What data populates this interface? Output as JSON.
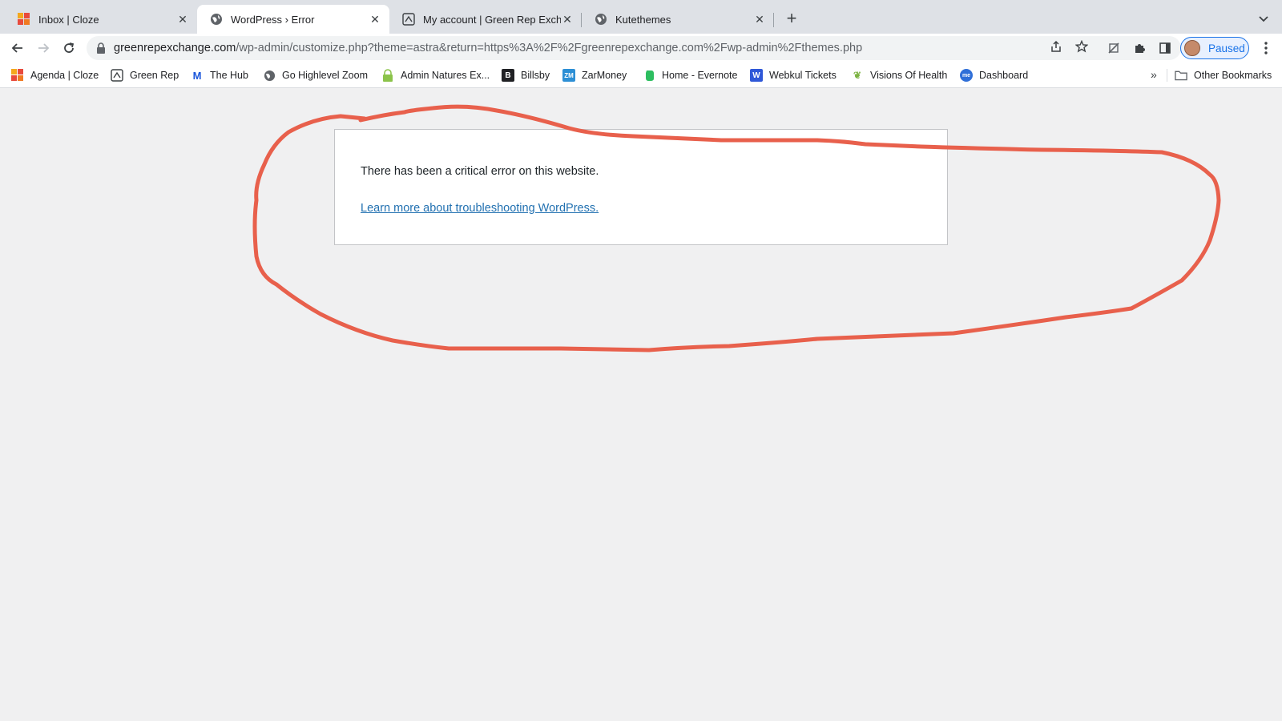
{
  "tabs": [
    {
      "title": "Inbox | Cloze",
      "icon": "cloze-icon",
      "active": false
    },
    {
      "title": "WordPress › Error",
      "icon": "globe-icon",
      "active": true
    },
    {
      "title": "My account | Green Rep Excha",
      "icon": "greenrep-icon",
      "active": false
    },
    {
      "title": "Kutethemes",
      "icon": "globe-icon",
      "active": false
    }
  ],
  "toolbar": {
    "url_host": "greenrepexchange.com",
    "url_path": "/wp-admin/customize.php?theme=astra&return=https%3A%2F%2Fgreenrepexchange.com%2Fwp-admin%2Fthemes.php",
    "profile_label": "Paused"
  },
  "bookmarks": {
    "items": [
      {
        "label": "Agenda | Cloze",
        "icon": "cloze-icon"
      },
      {
        "label": "Green Rep",
        "icon": "greenrep-icon"
      },
      {
        "label": "The Hub",
        "icon": "hub-icon"
      },
      {
        "label": "Go Highlevel Zoom",
        "icon": "globe-icon"
      },
      {
        "label": "Admin Natures Ex...",
        "icon": "lock-bag-icon"
      },
      {
        "label": "Billsby",
        "icon": "billsby-icon"
      },
      {
        "label": "ZarMoney",
        "icon": "zarmoney-icon"
      },
      {
        "label": "Home - Evernote",
        "icon": "evernote-icon"
      },
      {
        "label": "Webkul Tickets",
        "icon": "webkul-icon"
      },
      {
        "label": "Visions Of Health",
        "icon": "leaf-icon"
      },
      {
        "label": "Dashboard",
        "icon": "dashboard-icon"
      }
    ],
    "overflow": "»",
    "other_label": "Other Bookmarks"
  },
  "page": {
    "error_message": "There has been a critical error on this website.",
    "link_text": "Learn more about troubleshooting WordPress."
  },
  "colors": {
    "annotation_stroke": "#e8604c",
    "link": "#2271b1",
    "page_bg": "#f0f0f1"
  }
}
